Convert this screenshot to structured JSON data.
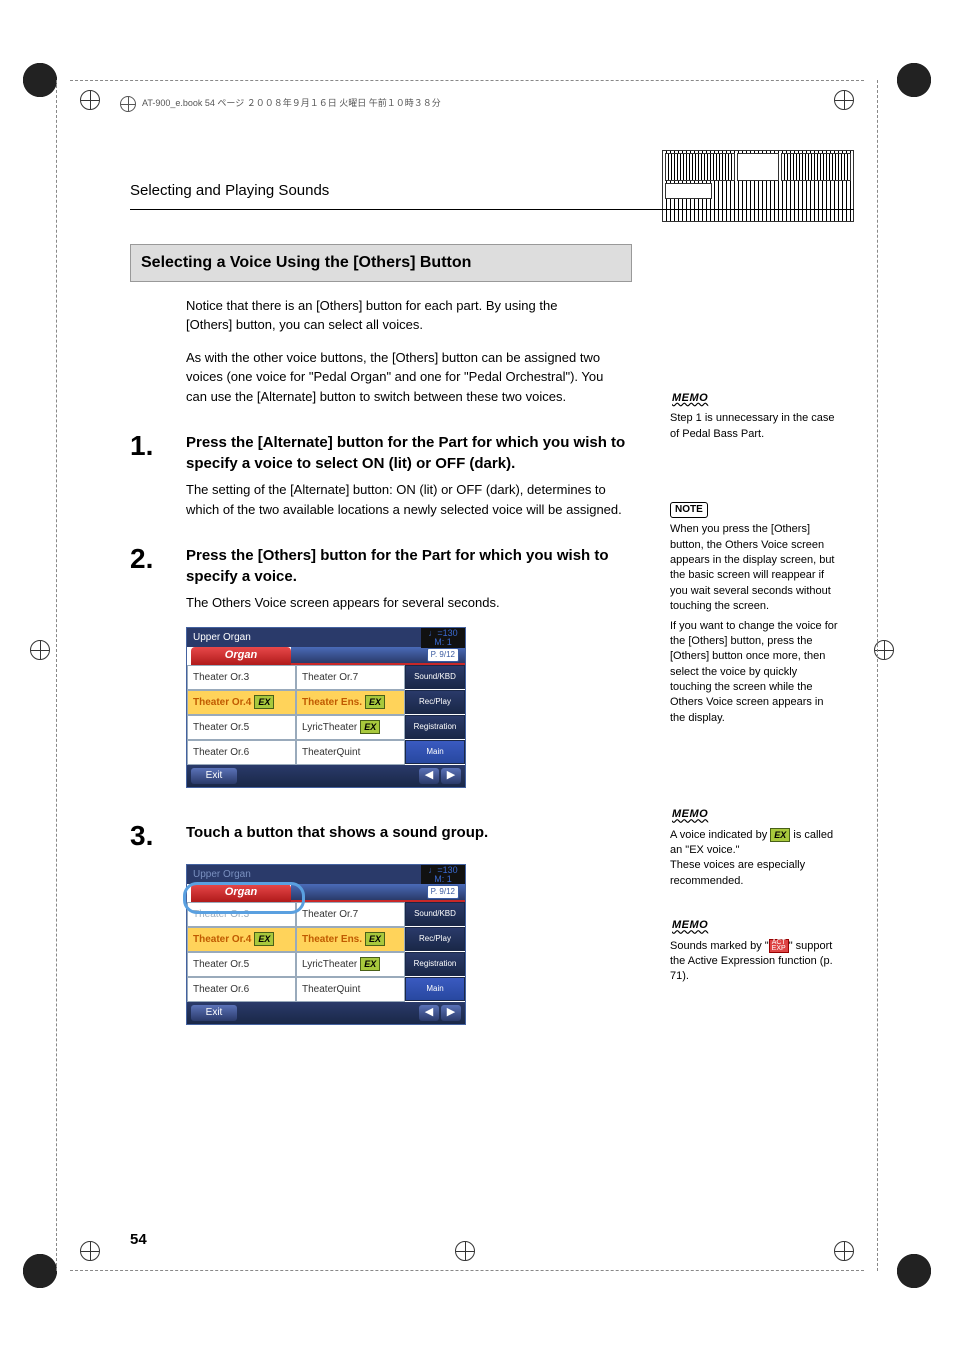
{
  "meta": {
    "book_line": "AT-900_e.book 54 ページ ２００８年９月１６日 火曜日 午前１０時３８分",
    "section_title": "Selecting and Playing Sounds",
    "page_number": "54"
  },
  "heading": "Selecting a Voice Using the [Others] Button",
  "intro": {
    "p1": "Notice that there is an [Others] button for each part. By using the [Others] button, you can select all voices.",
    "p2": "As with the other voice buttons, the [Others] button can be assigned two voices (one voice for \"Pedal Organ\" and one for \"Pedal Orchestral\"). You can use the [Alternate] button to switch between these two voices."
  },
  "steps": {
    "s1": {
      "num": "1.",
      "title": "Press the [Alternate] button for the Part for which you wish to specify a voice to select ON (lit) or OFF (dark).",
      "text": "The setting of the [Alternate] button: ON (lit) or OFF (dark), determines to which of the two available locations a newly selected voice will be assigned."
    },
    "s2": {
      "num": "2.",
      "title": "Press the [Others] button for the Part for which you wish to specify a voice.",
      "text": "The Others Voice screen appears for several seconds."
    },
    "s3": {
      "num": "3.",
      "title": "Touch a button that shows a sound group."
    }
  },
  "side": {
    "memo1_label": "MEMO",
    "memo1": "Step 1 is unnecessary in the case of Pedal Bass Part.",
    "note_label": "NOTE",
    "note_p1": "When you press the [Others] button, the Others Voice screen appears in the display screen, but the basic screen will reappear if you wait several seconds without touching the screen.",
    "note_p2": "If you want to change the voice for the [Others] button, press the [Others] button once more, then select the voice by quickly touching the screen while the Others Voice screen appears in the display.",
    "memo2_label": "MEMO",
    "memo2_a": "A voice indicated by ",
    "memo2_ex": "EX",
    "memo2_b": " is called an \"EX voice.\"",
    "memo2_c": "These voices are especially recommended.",
    "memo3_label": "MEMO",
    "memo3_a": "Sounds marked by \"",
    "memo3_b": "\" support the Active Expression function (p. 71)."
  },
  "screen": {
    "title": "Upper Organ",
    "tempo": "♩=130",
    "measure": "M:     1",
    "tab_active": "Organ",
    "page_indicator": "P. 9/12",
    "cells_left": [
      "Theater Or.3",
      "Theater Or.4",
      "Theater Or.5",
      "Theater Or.6"
    ],
    "cells_right": [
      "Theater Or.7",
      "Theater Ens.",
      "LyricTheater",
      "TheaterQuint"
    ],
    "ex_rows_left": [
      false,
      true,
      false,
      false
    ],
    "ex_rows_right": [
      false,
      true,
      true,
      false
    ],
    "sidebtns": [
      "Sound/KBD",
      "Rec/Play",
      "Registration",
      "Main"
    ],
    "exit": "Exit"
  }
}
